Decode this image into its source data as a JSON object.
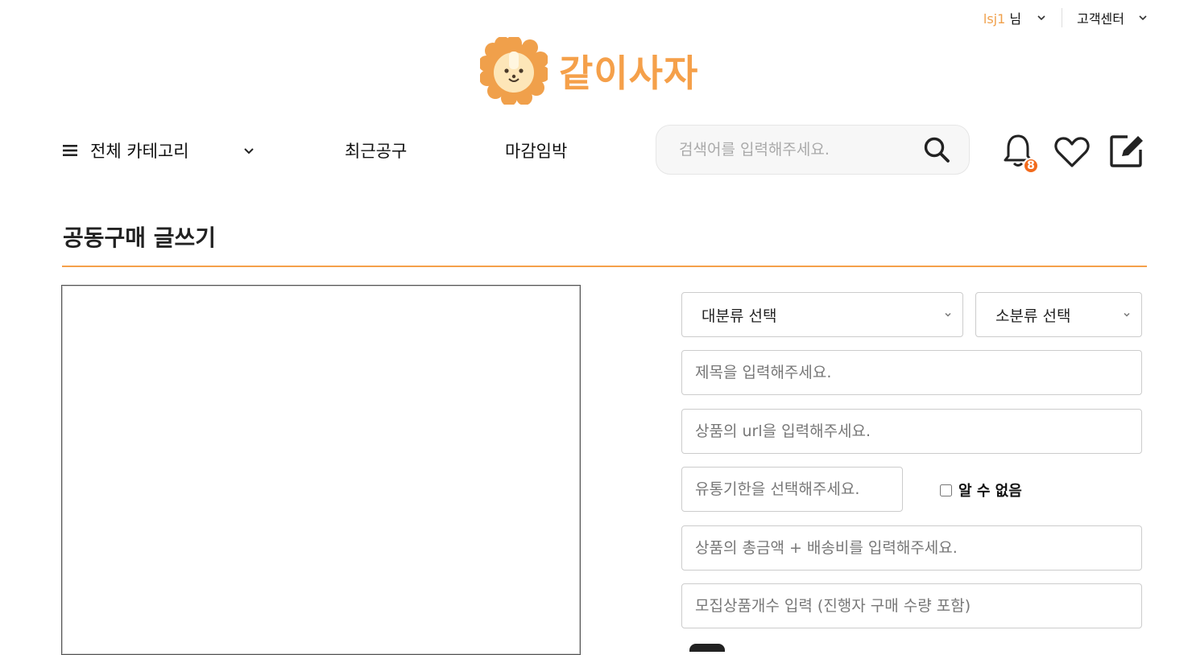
{
  "topbar": {
    "user_id": "lsj1",
    "user_suffix": "님",
    "customer_center": "고객센터"
  },
  "logo": {
    "text": "같이사자"
  },
  "nav": {
    "all_categories": "전체 카테고리",
    "recent": "최근공구",
    "closing_soon": "마감임박"
  },
  "search": {
    "placeholder": "검색어를 입력해주세요."
  },
  "notifications": {
    "count": "8"
  },
  "page": {
    "title": "공동구매 글쓰기"
  },
  "form": {
    "main_category": "대분류 선택",
    "sub_category": "소분류 선택",
    "title_placeholder": "제목을 입력해주세요.",
    "url_placeholder": "상품의 url을 입력해주세요.",
    "expiry_placeholder": "유통기한을 선택해주세요.",
    "unknown_label": "알 수 없음",
    "price_placeholder": "상품의 총금액 + 배송비를 입력해주세요.",
    "count_placeholder": "모집상품개수 입력 (진행자 구매 수량 포함)"
  },
  "colors": {
    "accent": "#f5a04a",
    "badge": "#f26b1d"
  }
}
